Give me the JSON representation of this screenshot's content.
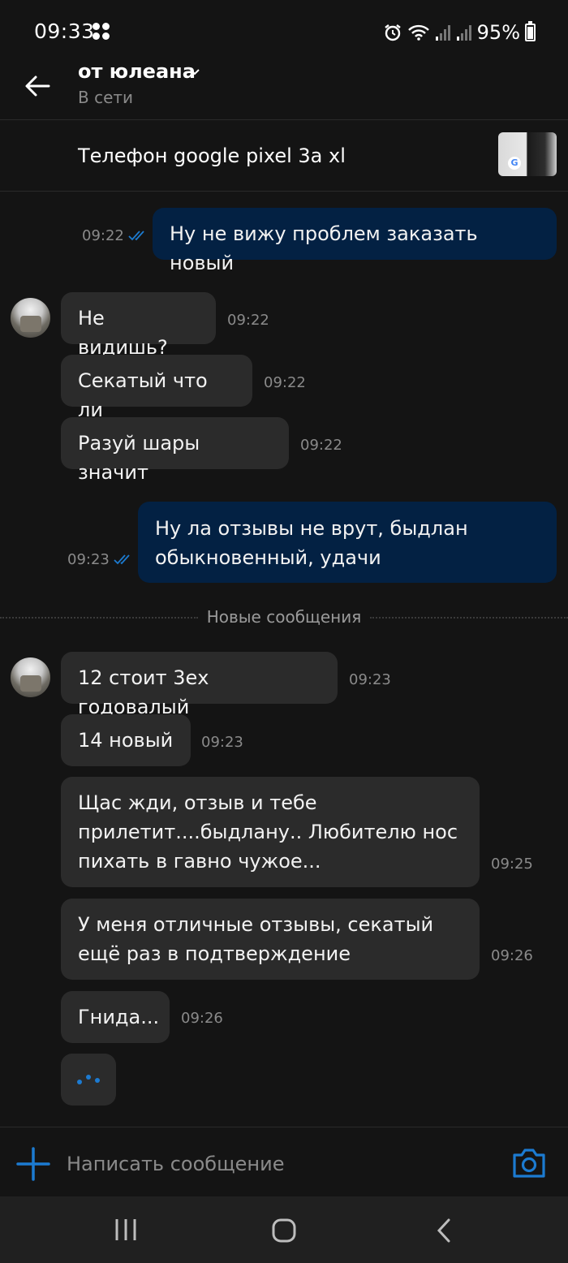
{
  "status_bar": {
    "time": "09:33",
    "battery": "95%",
    "icons": [
      "alarm-icon",
      "wifi-icon",
      "signal-icon",
      "signal-icon",
      "battery-icon"
    ]
  },
  "header": {
    "name": "от юлеана",
    "status": "В сети"
  },
  "item": {
    "title": "Телефон google pixel 3a xl",
    "thumb_logo": "G"
  },
  "messages": [
    {
      "dir": "out",
      "text": "Ну не вижу проблем заказать новый",
      "time": "09:22",
      "read": true
    },
    {
      "dir": "in",
      "text": "Не видишь?",
      "time": "09:22"
    },
    {
      "dir": "in",
      "text": "Секатый что ли",
      "time": "09:22"
    },
    {
      "dir": "in",
      "text": "Разуй шары значит",
      "time": "09:22"
    },
    {
      "dir": "out",
      "text": "Ну ла отзывы не врут, быдлан обыкновенный, удачи",
      "time": "09:23",
      "read": true
    },
    {
      "dir": "in",
      "text": "12 стоит 3ех годовалый",
      "time": "09:23"
    },
    {
      "dir": "in",
      "text": "14 новый",
      "time": "09:23"
    },
    {
      "dir": "in",
      "text": "Щас жди, отзыв и тебе прилетит....быдлану.. Любителю нос пихать в гавно чужое...",
      "time": "09:25"
    },
    {
      "dir": "in",
      "text": "У меня отличные отзывы, секатый ещё раз в подтверждение",
      "time": "09:26"
    },
    {
      "dir": "in",
      "text": "Гнида...",
      "time": "09:26"
    }
  ],
  "divider_label": "Новые сообщения",
  "composer": {
    "placeholder": "Написать сообщение"
  },
  "colors": {
    "background": "#141414",
    "incoming_bubble": "#2b2b2b",
    "outgoing_bubble": "#032143",
    "accent": "#1c7bd1",
    "muted_text": "#8a8a8a"
  }
}
